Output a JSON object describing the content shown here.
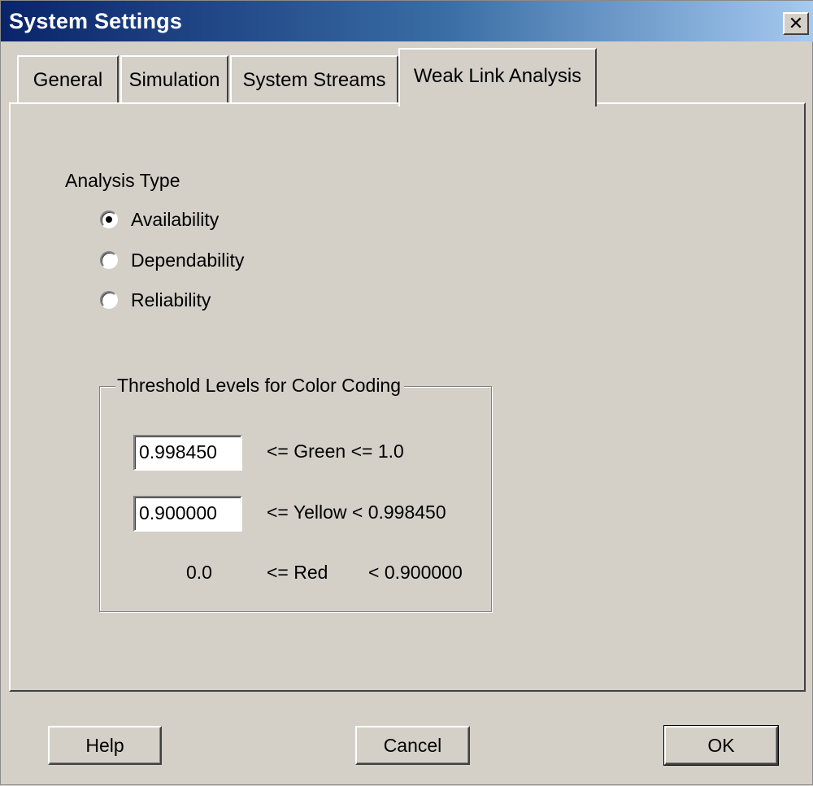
{
  "window": {
    "title": "System Settings",
    "close_glyph": "✕"
  },
  "tabs": [
    {
      "label": "General",
      "active": false
    },
    {
      "label": "Simulation",
      "active": false
    },
    {
      "label": "System Streams",
      "active": false
    },
    {
      "label": "Weak Link Analysis",
      "active": true
    }
  ],
  "analysis": {
    "title": "Analysis Type",
    "options": [
      {
        "label": "Availability",
        "selected": true
      },
      {
        "label": "Dependability",
        "selected": false
      },
      {
        "label": "Reliability",
        "selected": false
      }
    ]
  },
  "thresholds": {
    "title": "Threshold Levels for Color Coding",
    "green": {
      "value": "0.998450",
      "text": "<=  Green  <=  1.0"
    },
    "yellow": {
      "value": "0.900000",
      "text": "<=  Yellow  <  0.998450"
    },
    "red": {
      "low": "0.0",
      "op": "<=  Red",
      "high": "<  0.900000"
    }
  },
  "buttons": {
    "help": "Help",
    "cancel": "Cancel",
    "ok": "OK"
  }
}
